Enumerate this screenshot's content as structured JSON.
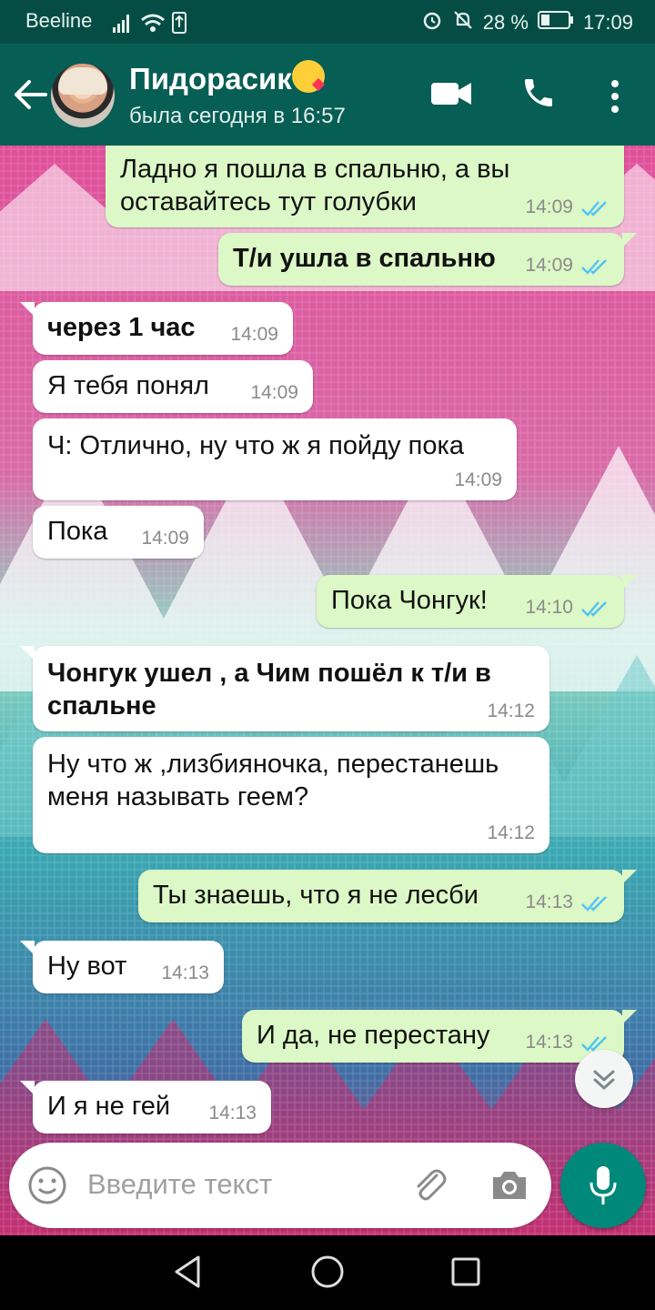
{
  "status_bar": {
    "carrier": "Beeline",
    "battery": "28 %",
    "time": "17:09"
  },
  "header": {
    "contact_name": "Пидорасик",
    "last_seen": "была сегодня в 16:57",
    "emoji": "kissing-face-emoji"
  },
  "messages": [
    {
      "dir": "out",
      "text": "Ладно я пошла в спальню, а вы оставайтесь тут голубки",
      "time": "14:09",
      "read": true
    },
    {
      "dir": "out",
      "text": "Т/и ушла в спальню",
      "time": "14:09",
      "read": true,
      "bold": true
    },
    {
      "dir": "in",
      "text": "через 1 час",
      "time": "14:09",
      "bold": true
    },
    {
      "dir": "in",
      "text": "Я тебя понял",
      "time": "14:09"
    },
    {
      "dir": "in",
      "text": "Ч: Отлично, ну что ж я пойду пока",
      "time": "14:09"
    },
    {
      "dir": "in",
      "text": "Пока",
      "time": "14:09"
    },
    {
      "dir": "out",
      "text": "Пока Чонгук!",
      "time": "14:10",
      "read": true
    },
    {
      "dir": "in",
      "text": "Чонгук ушел , а Чим пошёл к т/и в спальне",
      "time": "14:12",
      "bold": true
    },
    {
      "dir": "in",
      "text": "Ну что ж ,лизбияночка, перестанешь меня называть геем?",
      "time": "14:12"
    },
    {
      "dir": "out",
      "text": "Ты знаешь, что я не лесби",
      "time": "14:13",
      "read": true
    },
    {
      "dir": "in",
      "text": "Ну вот",
      "time": "14:13"
    },
    {
      "dir": "out",
      "text": "И да, не перестану",
      "time": "14:13",
      "read": true
    },
    {
      "dir": "in",
      "text": "И я не гей",
      "time": "14:13"
    }
  ],
  "input": {
    "placeholder": "Введите текст"
  },
  "colors": {
    "header": "#075e54",
    "status_bar": "#054d44",
    "out_bubble": "#dcf8c6",
    "in_bubble": "#ffffff",
    "accent": "#00897b",
    "read_tick": "#4fc3f7"
  }
}
